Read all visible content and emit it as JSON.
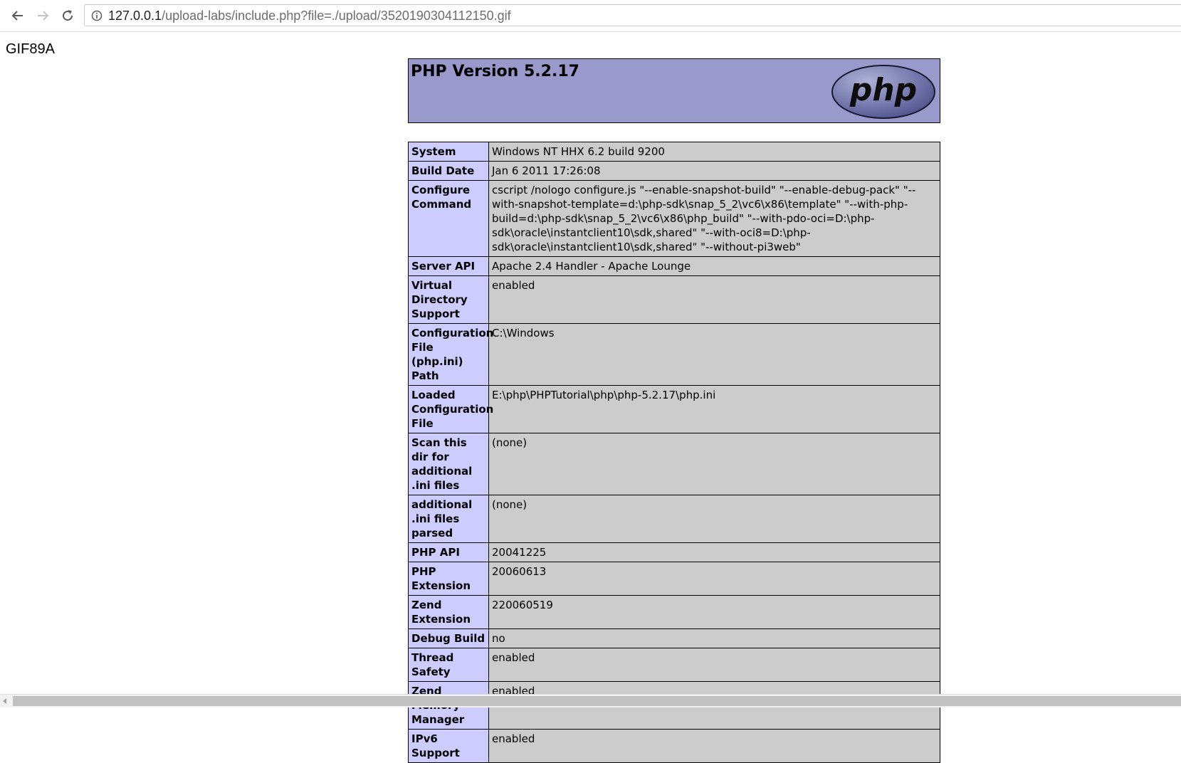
{
  "browser": {
    "url_host": "127.0.0.1",
    "url_rest": "/upload-labs/include.php?file=./upload/3520190304112150.gif",
    "icons": [
      "back-arrow-icon",
      "forward-arrow-icon",
      "reload-icon",
      "info-icon"
    ]
  },
  "page": {
    "gif_header": "GIF89A",
    "title": "PHP Version 5.2.17",
    "logo_text": "php",
    "colors": {
      "header_bg": "#9999cc",
      "label_bg": "#ccccff",
      "value_bg": "#cccccc"
    },
    "rows": [
      {
        "label": "System",
        "value": "Windows NT HHX 6.2 build 9200"
      },
      {
        "label": "Build Date",
        "value": "Jan 6 2011 17:26:08"
      },
      {
        "label": "Configure Command",
        "value": "cscript /nologo configure.js \"--enable-snapshot-build\" \"--enable-debug-pack\" \"--with-snapshot-template=d:\\php-sdk\\snap_5_2\\vc6\\x86\\template\" \"--with-php-build=d:\\php-sdk\\snap_5_2\\vc6\\x86\\php_build\" \"--with-pdo-oci=D:\\php-sdk\\oracle\\instantclient10\\sdk,shared\" \"--with-oci8=D:\\php-sdk\\oracle\\instantclient10\\sdk,shared\" \"--without-pi3web\""
      },
      {
        "label": "Server API",
        "value": "Apache 2.4 Handler - Apache Lounge"
      },
      {
        "label": "Virtual Directory Support",
        "value": "enabled"
      },
      {
        "label": "Configuration File (php.ini) Path",
        "value": "C:\\Windows"
      },
      {
        "label": "Loaded Configuration File",
        "value": "E:\\php\\PHPTutorial\\php\\php-5.2.17\\php.ini"
      },
      {
        "label": "Scan this dir for additional .ini files",
        "value": "(none)"
      },
      {
        "label": "additional .ini files parsed",
        "value": "(none)"
      },
      {
        "label": "PHP API",
        "value": "20041225"
      },
      {
        "label": "PHP Extension",
        "value": "20060613"
      },
      {
        "label": "Zend Extension",
        "value": "220060519"
      },
      {
        "label": "Debug Build",
        "value": "no"
      },
      {
        "label": "Thread Safety",
        "value": "enabled"
      },
      {
        "label": "Zend Memory Manager",
        "value": "enabled"
      },
      {
        "label": "IPv6 Support",
        "value": "enabled"
      }
    ]
  }
}
